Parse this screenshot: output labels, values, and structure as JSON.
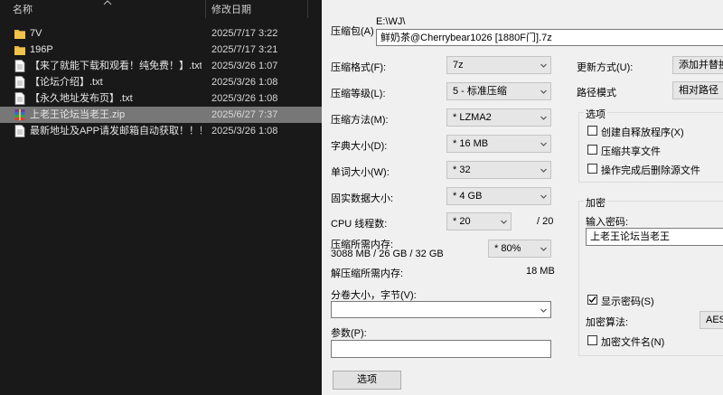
{
  "explorer": {
    "col_name": "名称",
    "col_date": "修改日期",
    "files": [
      {
        "name": "7V",
        "date": "2025/7/17 3:22",
        "type": "folder"
      },
      {
        "name": "196P",
        "date": "2025/7/17 3:21",
        "type": "folder"
      },
      {
        "name": "【来了就能下载和观看！纯免费！】.txt",
        "date": "2025/3/26 1:07",
        "type": "txt"
      },
      {
        "name": "【论坛介绍】.txt",
        "date": "2025/3/26 1:08",
        "type": "txt"
      },
      {
        "name": "【永久地址发布页】.txt",
        "date": "2025/3/26 1:08",
        "type": "txt"
      },
      {
        "name": "上老王论坛当老王.zip",
        "date": "2025/6/27 7:37",
        "type": "zip",
        "selected": true
      },
      {
        "name": "最新地址及APP请发邮箱自动获取！！！....",
        "date": "2025/3/26 1:08",
        "type": "txt"
      }
    ]
  },
  "dialog": {
    "archive_label": "压缩包(A)",
    "archive_path": "E:\\WJ\\",
    "archive_name": "鲜奶茶@Cherrybear1026 [1880F门].7z",
    "format_label": "压缩格式(F):",
    "format_value": "7z",
    "level_label": "压缩等级(L):",
    "level_value": "5 - 标准压缩",
    "method_label": "压缩方法(M):",
    "method_value": "* LZMA2",
    "dict_label": "字典大小(D):",
    "dict_value": "* 16 MB",
    "word_label": "单词大小(W):",
    "word_value": "* 32",
    "solid_label": "固实数据大小:",
    "solid_value": "* 4 GB",
    "cpu_label": "CPU 线程数:",
    "cpu_value": "* 20",
    "cpu_total": "/ 20",
    "mem_label": "压缩所需内存:",
    "mem_detail": "3088 MB / 26 GB / 32 GB",
    "mem_value": "* 80%",
    "decomp_label": "解压缩所需内存:",
    "decomp_value": "18 MB",
    "split_label": "分卷大小，字节(V):",
    "split_value": "",
    "params_label": "参数(P):",
    "params_value": "",
    "options_button": "选项",
    "update_label": "更新方式(U):",
    "update_value": "添加并替换",
    "path_label": "路径模式",
    "path_value": "相对路径",
    "options_group": "选项",
    "opt_sfx": "创建自释放程序(X)",
    "opt_shared": "压缩共享文件",
    "opt_delete": "操作完成后删除源文件",
    "encrypt_group": "加密",
    "password_label": "输入密码:",
    "password_value": "上老王论坛当老王",
    "show_password": "显示密码(S)",
    "enc_method_label": "加密算法:",
    "enc_method_value": "AES-",
    "enc_names": "加密文件名(N)"
  }
}
